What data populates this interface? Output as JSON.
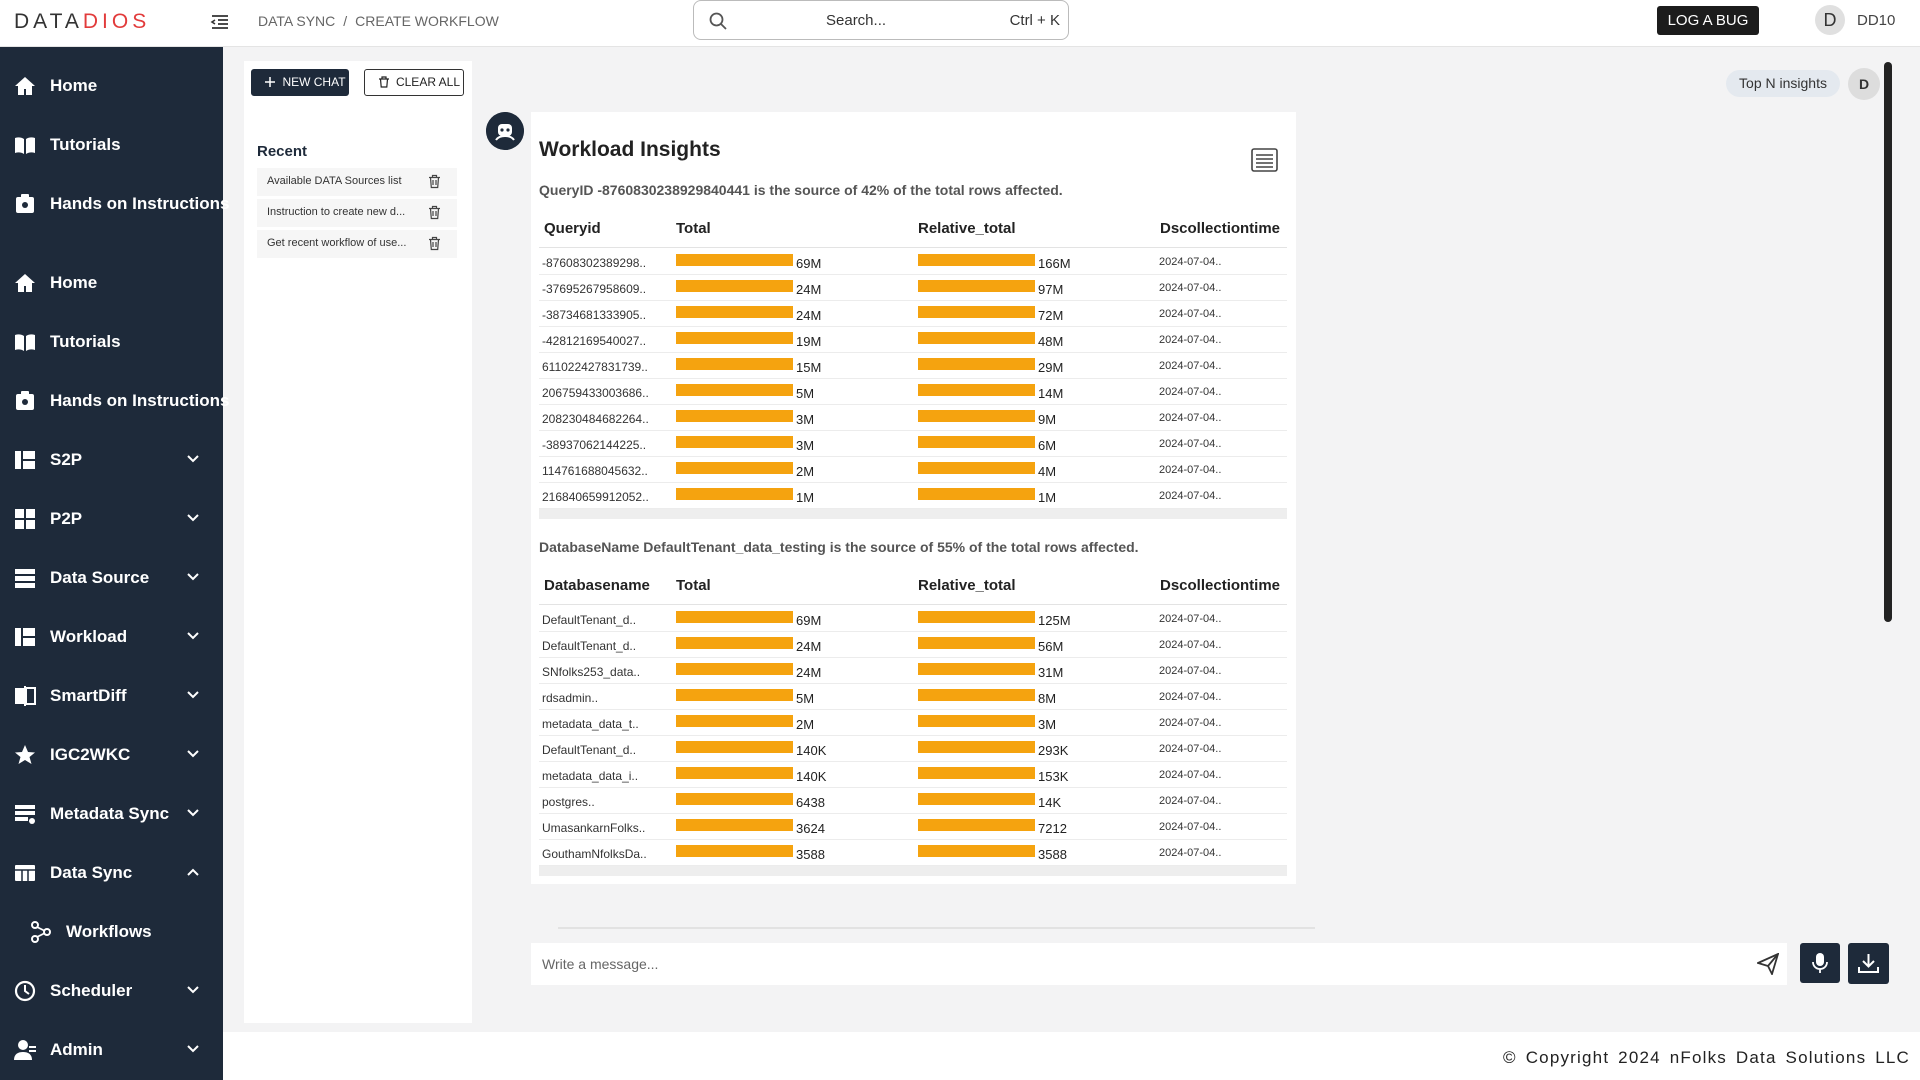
{
  "header": {
    "logo_prefix": "DATA",
    "logo_suffix": "DIOS",
    "breadcrumb": [
      "DATA SYNC",
      "CREATE WORKFLOW"
    ],
    "search_placeholder": "Search...",
    "search_shortcut": "Ctrl + K",
    "log_bug_label": "LOG A BUG",
    "avatar_initial": "D",
    "user_name": "DD10"
  },
  "sidebar": {
    "items": [
      {
        "label": "Home",
        "icon": "home-icon"
      },
      {
        "label": "Tutorials",
        "icon": "book-icon"
      },
      {
        "label": "Hands on Instructions",
        "icon": "instructions-icon"
      },
      {
        "label": "Home",
        "icon": "home-icon"
      },
      {
        "label": "Tutorials",
        "icon": "book-icon"
      },
      {
        "label": "Hands on Instructions",
        "icon": "instructions-icon"
      },
      {
        "label": "S2P",
        "icon": "dashboard-icon"
      },
      {
        "label": "P2P",
        "icon": "grid-icon"
      },
      {
        "label": "Data Source",
        "icon": "database-icon"
      },
      {
        "label": "Workload",
        "icon": "dashboard-icon"
      },
      {
        "label": "SmartDiff",
        "icon": "compare-icon"
      },
      {
        "label": "IGC2WKC",
        "icon": "star-icon"
      },
      {
        "label": "Metadata Sync",
        "icon": "layers-icon"
      },
      {
        "label": "Data Sync",
        "icon": "table-icon"
      },
      {
        "label": "Workflows",
        "icon": "workflow-icon"
      },
      {
        "label": "Scheduler",
        "icon": "clock-icon"
      },
      {
        "label": "Admin",
        "icon": "admin-icon"
      }
    ]
  },
  "chat_panel": {
    "new_chat_label": "NEW CHAT",
    "clear_all_label": "CLEAR ALL",
    "recent_title": "Recent",
    "recent": [
      "Available DATA Sources list",
      "Instruction to create new d...",
      "Get recent workflow of use..."
    ]
  },
  "main": {
    "top_insights_label": "Top N insights",
    "chat_avatar_initial": "D",
    "card_title": "Workload Insights",
    "message_placeholder": "Write a message..."
  },
  "tables": [
    {
      "summary": "QueryID -8760830238929840441 is the source of 42% of the total rows affected.",
      "headers": [
        "Queryid",
        "Total",
        "Relative_total",
        "Dscollectiontime"
      ],
      "rows": [
        {
          "id": "-87608302389298..",
          "total": "69M",
          "total_pct": 100,
          "rel": "166M",
          "rel_pct": 100,
          "time": "2024-07-04.."
        },
        {
          "id": "-37695267958609..",
          "total": "24M",
          "total_pct": 100,
          "rel": "97M",
          "rel_pct": 100,
          "time": "2024-07-04.."
        },
        {
          "id": "-38734681333905..",
          "total": "24M",
          "total_pct": 100,
          "rel": "72M",
          "rel_pct": 100,
          "time": "2024-07-04.."
        },
        {
          "id": "-42812169540027..",
          "total": "19M",
          "total_pct": 100,
          "rel": "48M",
          "rel_pct": 100,
          "time": "2024-07-04.."
        },
        {
          "id": "611022427831739..",
          "total": "15M",
          "total_pct": 100,
          "rel": "29M",
          "rel_pct": 100,
          "time": "2024-07-04.."
        },
        {
          "id": "206759433003686..",
          "total": "5M",
          "total_pct": 100,
          "rel": "14M",
          "rel_pct": 100,
          "time": "2024-07-04.."
        },
        {
          "id": "208230484682264..",
          "total": "3M",
          "total_pct": 100,
          "rel": "9M",
          "rel_pct": 100,
          "time": "2024-07-04.."
        },
        {
          "id": "-38937062144225..",
          "total": "3M",
          "total_pct": 100,
          "rel": "6M",
          "rel_pct": 100,
          "time": "2024-07-04.."
        },
        {
          "id": "114761688045632..",
          "total": "2M",
          "total_pct": 100,
          "rel": "4M",
          "rel_pct": 100,
          "time": "2024-07-04.."
        },
        {
          "id": "216840659912052..",
          "total": "1M",
          "total_pct": 100,
          "rel": "1M",
          "rel_pct": 100,
          "time": "2024-07-04.."
        }
      ]
    },
    {
      "summary": "DatabaseName DefaultTenant_data_testing is the source of 55% of the total rows affected.",
      "headers": [
        "Databasename",
        "Total",
        "Relative_total",
        "Dscollectiontime"
      ],
      "rows": [
        {
          "id": "DefaultTenant_d..",
          "total": "69M",
          "total_pct": 100,
          "rel": "125M",
          "rel_pct": 100,
          "time": "2024-07-04.."
        },
        {
          "id": "DefaultTenant_d..",
          "total": "24M",
          "total_pct": 100,
          "rel": "56M",
          "rel_pct": 100,
          "time": "2024-07-04.."
        },
        {
          "id": "SNfolks253_data..",
          "total": "24M",
          "total_pct": 100,
          "rel": "31M",
          "rel_pct": 100,
          "time": "2024-07-04.."
        },
        {
          "id": "rdsadmin..",
          "total": "5M",
          "total_pct": 100,
          "rel": "8M",
          "rel_pct": 100,
          "time": "2024-07-04.."
        },
        {
          "id": "metadata_data_t..",
          "total": "2M",
          "total_pct": 100,
          "rel": "3M",
          "rel_pct": 100,
          "time": "2024-07-04.."
        },
        {
          "id": "DefaultTenant_d..",
          "total": "140K",
          "total_pct": 100,
          "rel": "293K",
          "rel_pct": 100,
          "time": "2024-07-04.."
        },
        {
          "id": "metadata_data_i..",
          "total": "140K",
          "total_pct": 100,
          "rel": "153K",
          "rel_pct": 100,
          "time": "2024-07-04.."
        },
        {
          "id": "postgres..",
          "total": "6438",
          "total_pct": 100,
          "rel": "14K",
          "rel_pct": 100,
          "time": "2024-07-04.."
        },
        {
          "id": "UmasankarnFolks..",
          "total": "3624",
          "total_pct": 100,
          "rel": "7212",
          "rel_pct": 100,
          "time": "2024-07-04.."
        },
        {
          "id": "GouthamNfolksDa..",
          "total": "3588",
          "total_pct": 100,
          "rel": "3588",
          "rel_pct": 100,
          "time": "2024-07-04.."
        }
      ]
    }
  ],
  "footer": {
    "copyright": "© Copyright 2024 nFolks Data Solutions LLC"
  },
  "colors": {
    "sidebar_bg": "#1e2a3a",
    "bar_fill": "#f5a30f",
    "logo_accent": "#e23b3b"
  }
}
